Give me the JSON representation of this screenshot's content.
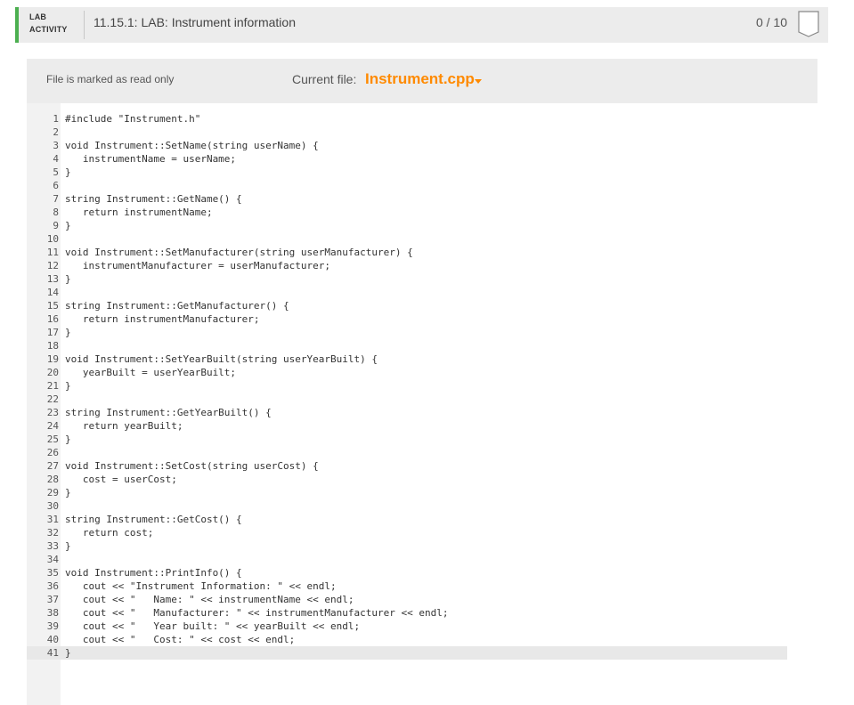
{
  "header": {
    "tag_line1": "LAB",
    "tag_line2": "ACTIVITY",
    "title": "11.15.1: LAB: Instrument information",
    "score": "0 / 10",
    "accent_color": "#4caf50"
  },
  "toolbar": {
    "readonly_text": "File is marked as read only",
    "current_file_label": "Current file:",
    "current_file": "Instrument.cpp",
    "file_color": "#ff8a00",
    "dropdown_icon": "caret-down-icon"
  },
  "editor": {
    "active_line": 41,
    "lines": [
      "#include \"Instrument.h\"",
      "",
      "void Instrument::SetName(string userName) {",
      "   instrumentName = userName;",
      "}",
      "",
      "string Instrument::GetName() {",
      "   return instrumentName;",
      "}",
      "",
      "void Instrument::SetManufacturer(string userManufacturer) {",
      "   instrumentManufacturer = userManufacturer;",
      "}",
      "",
      "string Instrument::GetManufacturer() {",
      "   return instrumentManufacturer;",
      "}",
      "",
      "void Instrument::SetYearBuilt(string userYearBuilt) {",
      "   yearBuilt = userYearBuilt;",
      "}",
      "",
      "string Instrument::GetYearBuilt() {",
      "   return yearBuilt;",
      "}",
      "",
      "void Instrument::SetCost(string userCost) {",
      "   cost = userCost;",
      "}",
      "",
      "string Instrument::GetCost() {",
      "   return cost;",
      "}",
      "",
      "void Instrument::PrintInfo() {",
      "   cout << \"Instrument Information: \" << endl;",
      "   cout << \"   Name: \" << instrumentName << endl;",
      "   cout << \"   Manufacturer: \" << instrumentManufacturer << endl;",
      "   cout << \"   Year built: \" << yearBuilt << endl;",
      "   cout << \"   Cost: \" << cost << endl;",
      "}"
    ]
  }
}
